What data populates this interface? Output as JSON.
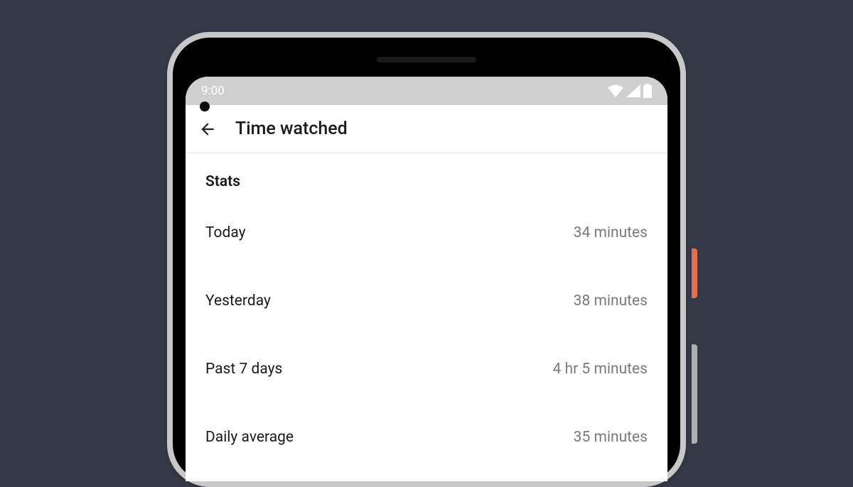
{
  "status_bar": {
    "time": "9:00"
  },
  "app_bar": {
    "title": "Time watched"
  },
  "section": {
    "header": "Stats"
  },
  "stats": [
    {
      "label": "Today",
      "value": "34 minutes"
    },
    {
      "label": "Yesterday",
      "value": "38 minutes"
    },
    {
      "label": "Past 7 days",
      "value": "4 hr 5 minutes"
    },
    {
      "label": "Daily average",
      "value": "35 minutes"
    }
  ]
}
